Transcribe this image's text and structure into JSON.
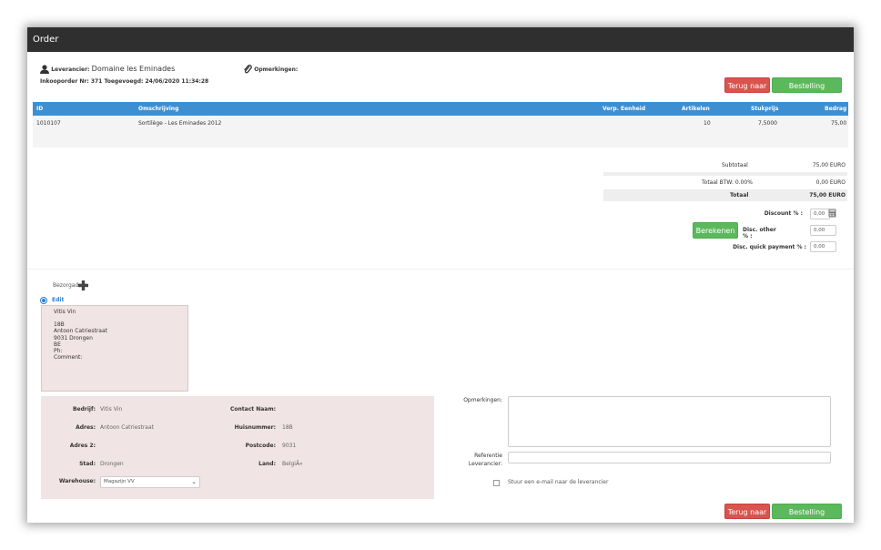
{
  "window": {
    "title": "Order"
  },
  "header": {
    "supplier_label": "Leverancier:",
    "supplier_value": "Domaine les Eminades",
    "remarks_label": "Opmerkingen:",
    "order_info": "Inkooporder Nr: 371 Toegevoegd: 24/06/2020 11:34:28"
  },
  "buttons": {
    "back": "Terug naar",
    "finish": "Bestelling afronden",
    "calculate": "Berekenen"
  },
  "table": {
    "headers": [
      "ID",
      "Omschrijving",
      "Verp. Eenheid",
      "Artikelen",
      "Stukprijs",
      "Bedrag"
    ],
    "rows": [
      {
        "id": "1010107",
        "desc": "Sortilège - Les Eminades 2012",
        "unit": "",
        "articles": "10",
        "price": "7,5000",
        "amount": "75,00"
      }
    ]
  },
  "summary": {
    "subtotal_label": "Subtotaal",
    "subtotal_value": "75,00 EURO",
    "vat_label": "Totaal BTW: 0.00%",
    "vat_value": "0,00 EURO",
    "total_label": "Totaal",
    "total_value": "75,00 EURO",
    "discount_label": "Discount % :",
    "discount_value": "0,00",
    "disc_other_label": "Disc. other % :",
    "disc_other_value": "0,00",
    "disc_quick_label": "Disc. quick payment % :",
    "disc_quick_value": "0,00"
  },
  "delivery": {
    "label": "Bezorgadres:",
    "edit_label": "Edit",
    "address_lines": [
      "Vitis Vin",
      "",
      "18B",
      "Antoon Catriestraat",
      "9031 Drongen",
      "BE",
      "Ph:",
      "Comment:"
    ]
  },
  "form": {
    "company_label": "Bedrijf:",
    "company_value": "Vitis Vin",
    "contact_label": "Contact Naam:",
    "contact_value": "",
    "address_label": "Adres:",
    "address_value": "Antoon Catriestraat",
    "housenr_label": "Huisnummer:",
    "housenr_value": "18B",
    "address2_label": "Adres 2:",
    "address2_value": "",
    "postcode_label": "Postcode:",
    "postcode_value": "9031",
    "city_label": "Stad:",
    "city_value": "Drongen",
    "country_label": "Land:",
    "country_value": "BelgiÃ«",
    "warehouse_label": "Warehouse:",
    "warehouse_value": "Magazijn VV"
  },
  "notes": {
    "remarks_label": "Opmerkingen:",
    "reference_label_1": "Referentie",
    "reference_label_2": "Leverancier:",
    "email_label": "Stuur een e-mail naar de leverancier"
  }
}
